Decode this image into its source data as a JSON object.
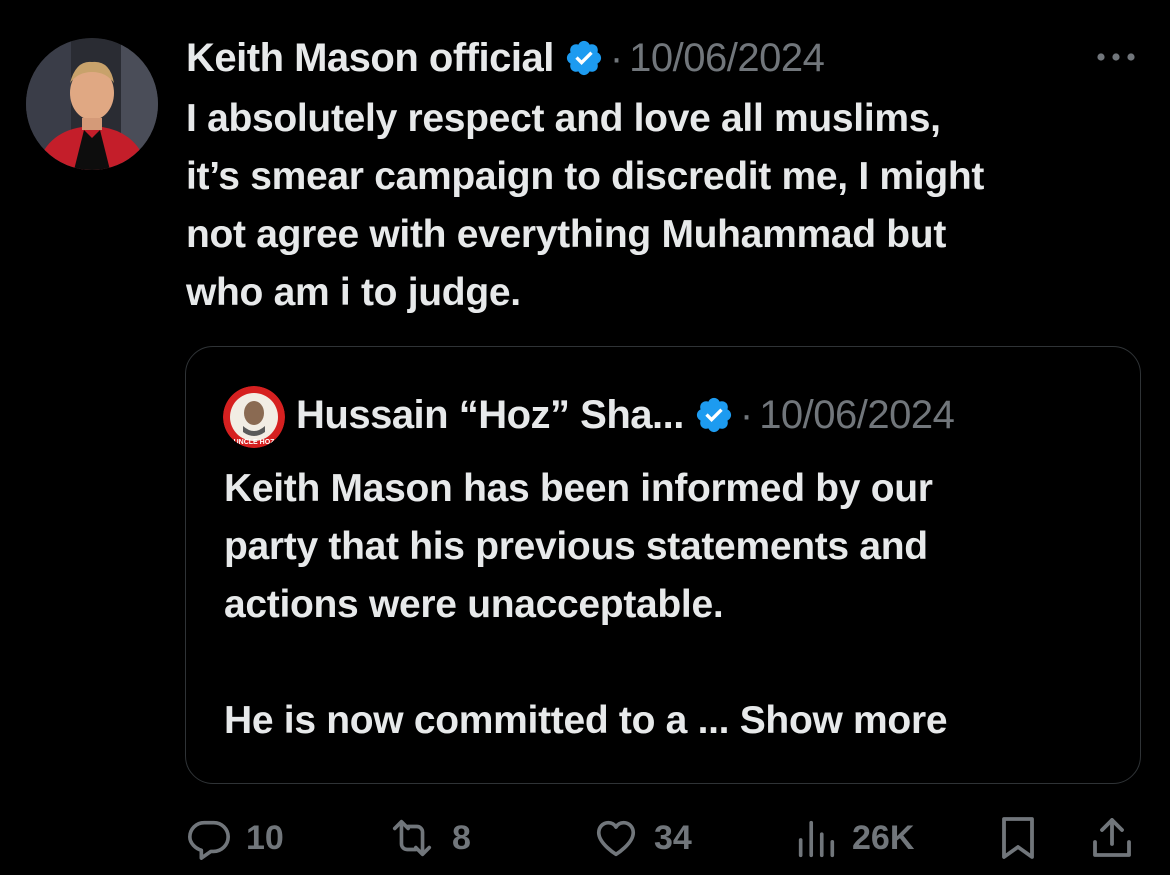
{
  "tweet": {
    "author_name": "Keith Mason official",
    "separator": "·",
    "date": "10/06/2024",
    "more_icon": "more-horizontal-icon",
    "text_lines": [
      "I absolutely respect and love all muslims,",
      "it’s smear campaign to discredit me, I might",
      "not agree with everything Muhammad but",
      "who am i to judge."
    ]
  },
  "quote": {
    "author_name": "Hussain “Hoz” Sha...",
    "separator": "·",
    "date": "10/06/2024",
    "avatar_text": "UNCLE HOZ",
    "text_lines": [
      "Keith Mason has been informed by our",
      "party that his previous statements and",
      "actions were unacceptable."
    ],
    "truncated_line": "He is now committed to a ...",
    "show_more_label": "Show more"
  },
  "actions": {
    "reply": {
      "icon": "reply-icon",
      "count": "10"
    },
    "repost": {
      "icon": "repost-icon",
      "count": "8"
    },
    "like": {
      "icon": "heart-icon",
      "count": "34"
    },
    "views": {
      "icon": "views-chart-icon",
      "count": "26K"
    },
    "bookmark": {
      "icon": "bookmark-icon"
    },
    "share": {
      "icon": "share-icon"
    }
  },
  "colors": {
    "background": "#000000",
    "text_primary": "#e7e9ea",
    "text_secondary": "#71767b",
    "verified_blue": "#1d9bf0",
    "border": "#2f3336"
  }
}
